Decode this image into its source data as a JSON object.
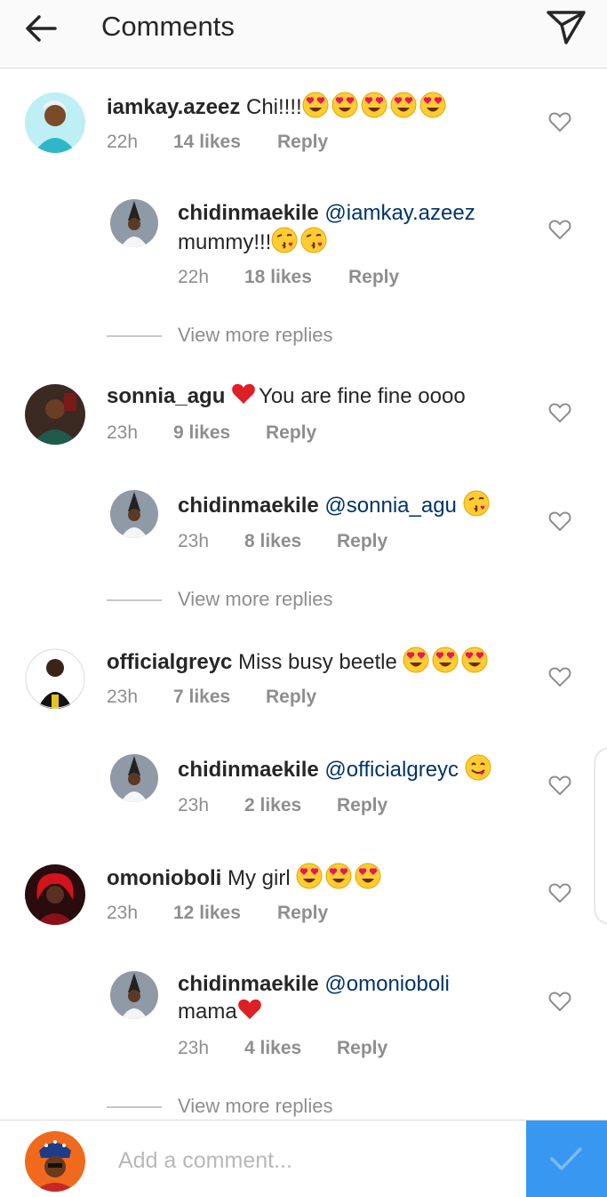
{
  "header": {
    "title": "Comments"
  },
  "comments": [
    {
      "user": "iamkay.azeez",
      "text": " Chi!!!!",
      "emoji": [
        "heart-eyes",
        "heart-eyes",
        "heart-eyes",
        "heart-eyes",
        "heart-eyes"
      ],
      "time": "22h",
      "likes": "14 likes",
      "reply": "Reply",
      "avatar_color": "#2fb7c9",
      "reply_item": {
        "user": "chidinmaekile",
        "mention": "@iamkay.azeez",
        "text": "mummy!!!",
        "emoji": [
          "kiss-heart",
          "kiss-heart"
        ],
        "time": "22h",
        "likes": "18 likes",
        "reply": "Reply"
      },
      "view_more": "View more replies"
    },
    {
      "user": "sonnia_agu",
      "text": "You are fine fine oooo",
      "emoji_before": [
        "red-heart"
      ],
      "time": "23h",
      "likes": "9 likes",
      "reply": "Reply",
      "avatar_color": "#2e4a3a",
      "reply_item": {
        "user": "chidinmaekile",
        "mention": "@sonnia_agu",
        "text": "",
        "emoji": [
          "kiss-heart"
        ],
        "time": "23h",
        "likes": "8 likes",
        "reply": "Reply"
      },
      "view_more": "View more replies"
    },
    {
      "user": "officialgreyc",
      "text": " Miss busy beetle ",
      "emoji": [
        "heart-eyes",
        "heart-eyes",
        "heart-eyes"
      ],
      "time": "23h",
      "likes": "7 likes",
      "reply": "Reply",
      "avatar_color": "#1a1a1a",
      "reply_item": {
        "user": "chidinmaekile",
        "mention": "@officialgreyc",
        "text": "",
        "emoji": [
          "yum-face"
        ],
        "time": "23h",
        "likes": "2 likes",
        "reply": "Reply"
      }
    },
    {
      "user": "omonioboli",
      "text": " My girl ",
      "emoji": [
        "heart-eyes",
        "heart-eyes",
        "heart-eyes"
      ],
      "time": "23h",
      "likes": "12 likes",
      "reply": "Reply",
      "avatar_color": "#b5121b",
      "reply_item": {
        "user": "chidinmaekile",
        "mention": "@omonioboli",
        "text": "mama",
        "emoji": [
          "red-heart"
        ],
        "time": "23h",
        "likes": "4 likes",
        "reply": "Reply"
      },
      "view_more": "View more replies"
    }
  ],
  "composer": {
    "placeholder": "Add a comment..."
  },
  "colors": {
    "accent": "#3897f0",
    "mention": "#003569",
    "meta": "#8e8e8e"
  },
  "icons": [
    "back-arrow-icon",
    "send-icon",
    "heart-outline-icon",
    "checkmark-icon"
  ]
}
